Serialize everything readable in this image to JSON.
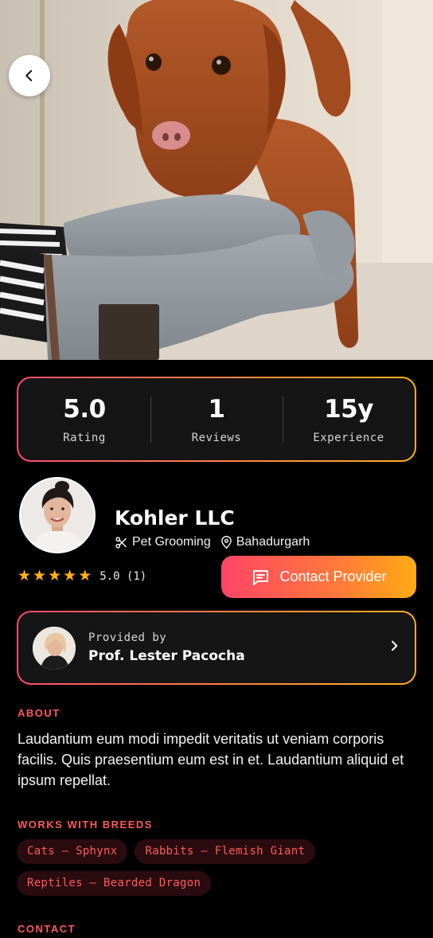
{
  "hero": {
    "image_alt": "hero-photo-dog-with-grooming-gloves"
  },
  "navigation": {
    "back_icon": "chevron-left-icon"
  },
  "stats": [
    {
      "value": "5.0",
      "label": "Rating"
    },
    {
      "value": "1",
      "label": "Reviews"
    },
    {
      "value": "15y",
      "label": "Experience"
    }
  ],
  "provider": {
    "name": "Kohler LLC",
    "category": "Pet Grooming",
    "category_icon": "scissors-icon",
    "location": "Bahadurgarh",
    "location_icon": "map-pin-icon",
    "stars": 5,
    "rating_text": "5.0 (1)"
  },
  "contact_button": {
    "label": "Contact Provider",
    "icon": "chat-bubble-icon"
  },
  "provided_by": {
    "label": "Provided by",
    "name": "Prof. Lester Pacocha",
    "chevron_icon": "chevron-right-icon"
  },
  "about": {
    "title": "ABOUT",
    "text": "Laudantium eum modi impedit veritatis ut veniam corporis facilis. Quis praesentium eum est in et. Laudantium aliquid et ipsum repellat."
  },
  "breeds": {
    "title": "WORKS WITH BREEDS",
    "items": [
      "Cats — Sphynx",
      "Rabbits — Flemish Giant",
      "Reptiles — Bearded Dragon"
    ]
  },
  "contact": {
    "title": "CONTACT"
  },
  "colors": {
    "accent_start": "#ff4d6d",
    "accent_end": "#ffb020",
    "star": "#ffb21e",
    "section_title": "#ff5a5a",
    "background": "#000000"
  }
}
